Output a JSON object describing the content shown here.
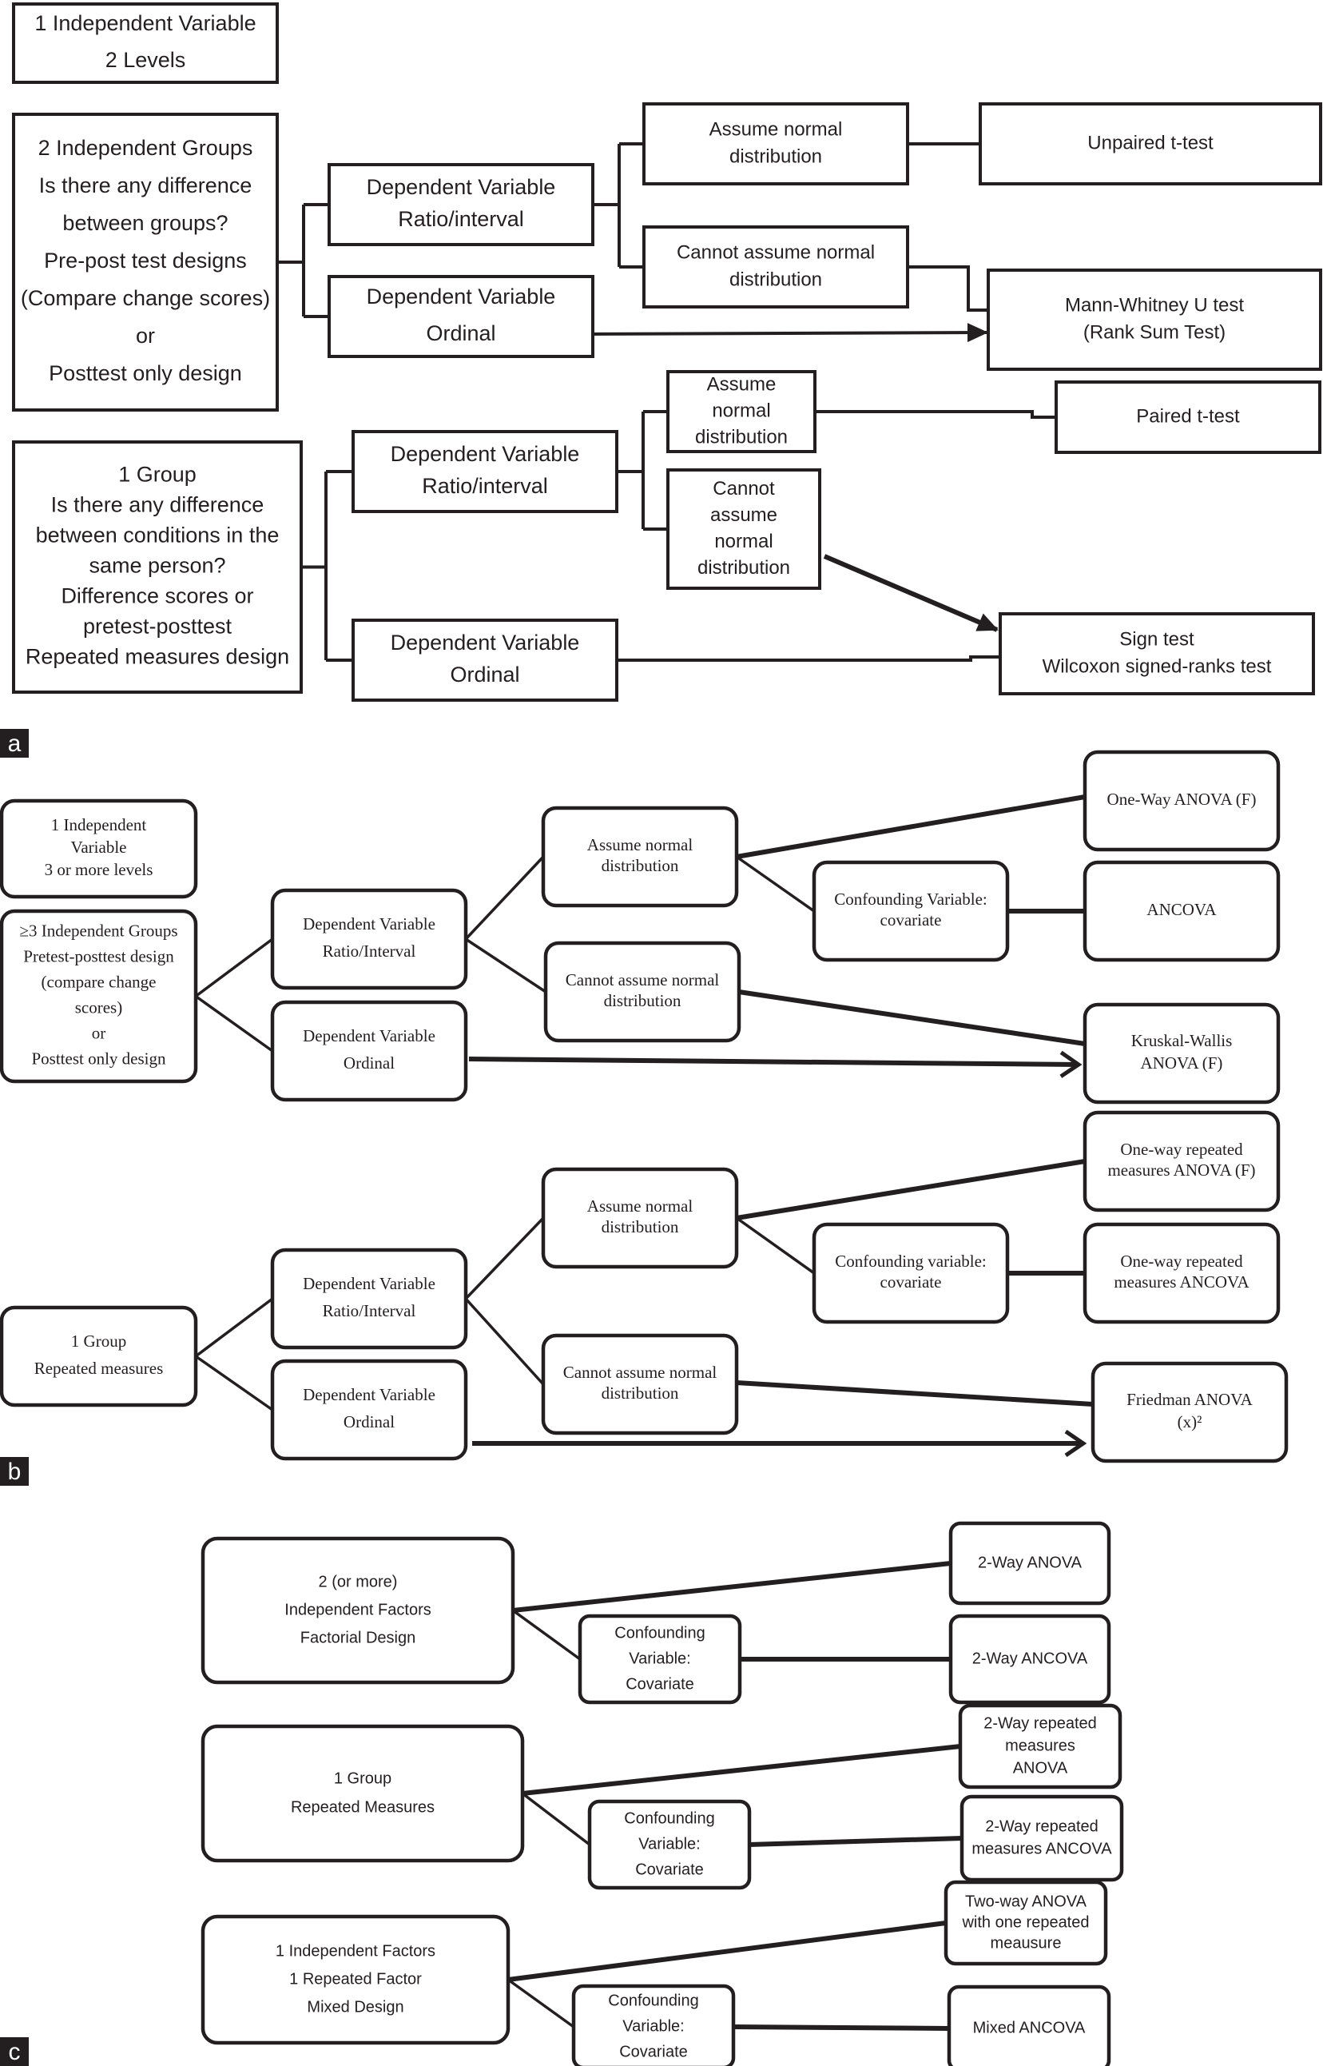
{
  "panels": [
    {
      "label": "a",
      "nodes": {
        "iv_header": [
          "1 Independent Variable",
          "2 Levels"
        ],
        "two_groups": [
          "2 Independent Groups",
          "Is there any difference",
          "between groups?",
          "Pre-post test designs",
          "(Compare change scores)",
          "or",
          "Posttest only design"
        ],
        "dv_ratio_1": [
          "Dependent Variable",
          "Ratio/interval"
        ],
        "dv_ordinal_1": [
          "Dependent Variable",
          "Ordinal"
        ],
        "assume_normal_1": [
          "Assume normal",
          "distribution"
        ],
        "cannot_assume_1": [
          "Cannot assume normal",
          "distribution"
        ],
        "unpaired_t": [
          "Unpaired t-test"
        ],
        "mann_whitney": [
          "Mann-Whitney U test",
          "(Rank Sum Test)"
        ],
        "one_group": [
          "1 Group",
          "Is there any difference",
          "between conditions in the",
          "same person?",
          "Difference scores or",
          "pretest-posttest",
          "Repeated measures design"
        ],
        "dv_ratio_2": [
          "Dependent Variable",
          "Ratio/interval"
        ],
        "dv_ordinal_2": [
          "Dependent Variable",
          "Ordinal"
        ],
        "assume_normal_2": [
          "Assume",
          "normal",
          "distribution"
        ],
        "cannot_assume_2": [
          "Cannot",
          "assume",
          "normal",
          "distribution"
        ],
        "paired_t": [
          "Paired t-test"
        ],
        "sign_test": [
          "Sign test",
          "Wilcoxon signed-ranks test"
        ]
      }
    },
    {
      "label": "b",
      "nodes": {
        "iv_header": [
          "1 Independent",
          "Variable",
          "3 or more levels"
        ],
        "three_groups": [
          "≥3 Independent Groups",
          "Pretest-posttest design",
          "(compare change",
          "scores)",
          "or",
          "Posttest only design"
        ],
        "dv_ratio_1": [
          "Dependent Variable",
          "Ratio/Interval"
        ],
        "dv_ordinal_1": [
          "Dependent Variable",
          "Ordinal"
        ],
        "assume_normal_1": [
          "Assume normal",
          "distribution"
        ],
        "cannot_assume_1": [
          "Cannot assume normal",
          "distribution"
        ],
        "confound_1": [
          "Confounding Variable:",
          "covariate"
        ],
        "one_way_anova": [
          "One-Way ANOVA (F)"
        ],
        "ancova": [
          "ANCOVA"
        ],
        "kruskal": [
          "Kruskal-Wallis",
          "ANOVA (F)"
        ],
        "one_group": [
          "1 Group",
          "Repeated measures"
        ],
        "dv_ratio_2": [
          "Dependent Variable",
          "Ratio/Interval"
        ],
        "dv_ordinal_2": [
          "Dependent Variable",
          "Ordinal"
        ],
        "assume_normal_2": [
          "Assume normal",
          "distribution"
        ],
        "cannot_assume_2": [
          "Cannot assume normal",
          "distribution"
        ],
        "confound_2": [
          "Confounding variable:",
          "covariate"
        ],
        "rm_anova": [
          "One-way repeated",
          "measures ANOVA (F)"
        ],
        "rm_ancova": [
          "One-way repeated",
          "measures ANCOVA"
        ],
        "friedman": [
          "Friedman ANOVA",
          "(x)²"
        ]
      }
    },
    {
      "label": "c",
      "nodes": {
        "factorial": [
          "2 (or more)",
          "Independent Factors",
          "Factorial Design"
        ],
        "confound_1": [
          "Confounding",
          "Variable:",
          "Covariate"
        ],
        "two_way_anova": [
          "2-Way ANOVA"
        ],
        "two_way_ancova": [
          "2-Way ANCOVA"
        ],
        "one_group_rm": [
          "1 Group",
          "Repeated Measures"
        ],
        "confound_2": [
          "Confounding",
          "Variable:",
          "Covariate"
        ],
        "rm2_anova": [
          "2-Way repeated",
          "measures",
          "ANOVA"
        ],
        "rm2_ancova": [
          "2-Way repeated",
          "measures  ANCOVA"
        ],
        "mixed": [
          "1 Independent Factors",
          "1 Repeated Factor",
          "Mixed Design"
        ],
        "confound_3": [
          "Confounding",
          "Variable:",
          "Covariate"
        ],
        "two_way_one_rm": [
          "Two-way ANOVA",
          "with one repeated",
          "meausure"
        ],
        "mixed_ancova": [
          "Mixed ANCOVA"
        ]
      }
    }
  ]
}
